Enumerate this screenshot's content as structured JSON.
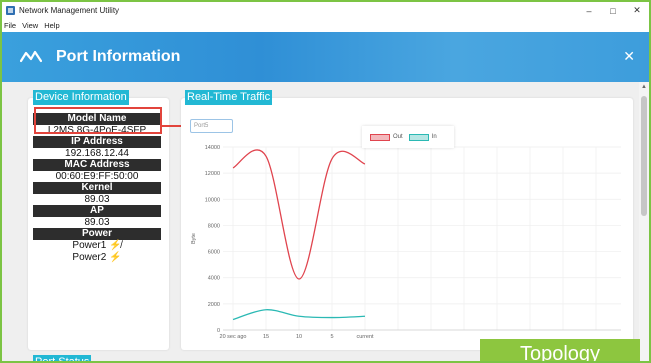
{
  "window": {
    "title": "Network Management Utility",
    "minimize_glyph": "–",
    "maximize_glyph": "□",
    "close_glyph": "✕"
  },
  "menu": [
    "File",
    "View",
    "Help"
  ],
  "header": {
    "title": "Port Information",
    "icon": "pulse-icon",
    "close_glyph": "✕"
  },
  "sections": {
    "device_info": "Device Information",
    "realtime_traffic": "Real-Time Traffic",
    "port_status": "Port Status"
  },
  "device": {
    "model_name_label": "Model Name",
    "model_name": "L2MS 8G-4PoE-4SFP",
    "ip_label": "IP Address",
    "ip": "192.168.12.44",
    "mac_label": "MAC Address",
    "mac": "00:60:E9:FF:50:00",
    "kernel_label": "Kernel",
    "kernel": "89.03",
    "ap_label": "AP",
    "ap": "89.03",
    "power_label": "Power",
    "power1": "Power1",
    "power2": "Power2"
  },
  "port_select": "Port5",
  "topology_button": "Topology",
  "colors": {
    "accent": "#22b8d4",
    "header": "#2f8fd6",
    "out": "#e0444e",
    "in": "#2bb9b4",
    "topology": "#8dc63f",
    "highlight": "#e2443c"
  },
  "chart_data": {
    "type": "line",
    "x": [
      "20 sec ago",
      "15",
      "10",
      "5",
      "current"
    ],
    "ylabel": "Byte",
    "ylim": [
      0,
      14000
    ],
    "yticks": [
      0,
      2000,
      4000,
      6000,
      8000,
      10000,
      12000,
      14000
    ],
    "grid": true,
    "legend_position": "top-right",
    "series": [
      {
        "name": "Out",
        "values": [
          12400,
          13300,
          3900,
          13100,
          12700
        ]
      },
      {
        "name": "In",
        "values": [
          800,
          1550,
          1050,
          950,
          1050
        ]
      }
    ]
  }
}
